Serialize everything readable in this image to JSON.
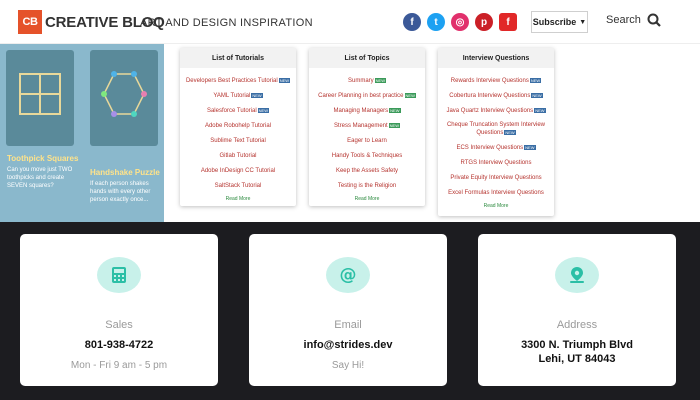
{
  "header": {
    "logo_badge": "CB",
    "logo_text": "CREATIVE BLOQ",
    "tagline": "ART AND DESIGN INSPIRATION",
    "social": [
      {
        "icon": "facebook-icon",
        "glyph": "f",
        "color": "#3b5998"
      },
      {
        "icon": "twitter-icon",
        "glyph": "t",
        "color": "#1da1f2"
      },
      {
        "icon": "instagram-icon",
        "glyph": "◎",
        "color": "#e1306c"
      },
      {
        "icon": "pinterest-icon",
        "glyph": "p",
        "color": "#cb2027"
      },
      {
        "icon": "flipboard-icon",
        "glyph": "f",
        "color": "#e12828"
      }
    ],
    "subscribe_label": "Subscribe",
    "search_label": "Search"
  },
  "puzzles": [
    {
      "title": "Toothpick Squares",
      "desc": "Can you move just TWO toothpicks and create SEVEN squares?"
    },
    {
      "title": "Handshake Puzzle",
      "desc": "If each person shakes hands with every other person exactly once..."
    }
  ],
  "tutorials": {
    "title": "List of Tutorials",
    "items": [
      "Developers Best Practices Tutorial",
      "YAML Tutorial",
      "Salesforce Tutorial",
      "Adobe Robohelp Tutorial",
      "Sublime Text Tutorial",
      "Gitlab Tutorial",
      "Adobe InDesign CC Tutorial",
      "SaltStack Tutorial"
    ],
    "read_more": "Read More"
  },
  "topics": {
    "title": "List of Topics",
    "items": [
      "Summary",
      "Career Planning in best practice",
      "Managing Managers",
      "Stress Management",
      "Eager to Learn",
      "Handy Tools & Techniques",
      "Keep the Assets Safety",
      "Testing is the Religion"
    ],
    "read_more": "Read More"
  },
  "interview": {
    "title": "Interview Questions",
    "items": [
      "Rewards Interview Questions",
      "Cobertura Interview Questions",
      "Java Quartz Interview Questions",
      "Cheque Truncation System Interview Questions",
      "ECS Interview Questions",
      "RTGS Interview Questions",
      "Private Equity Interview Questions",
      "Excel Formulas Interview Questions"
    ],
    "read_more": "Read More"
  },
  "new_tag": "NEW",
  "contacts": [
    {
      "icon": "calculator-icon",
      "label": "Sales",
      "value": "801-938-4722",
      "value2": "",
      "sub": "Mon - Fri 9 am - 5 pm"
    },
    {
      "icon": "at-sign-icon",
      "label": "Email",
      "value": "info@strides.dev",
      "value2": "",
      "sub": "Say Hi!"
    },
    {
      "icon": "map-pin-icon",
      "label": "Address",
      "value": "3300 N. Triumph Blvd",
      "value2": "Lehi, UT 84043",
      "sub": ""
    }
  ],
  "colors": {
    "accent": "#e5522a",
    "teal_light": "#c8f1ea",
    "teal": "#2bbfa6",
    "dark_bg": "#1c1c20",
    "link_red": "#b5332e"
  }
}
